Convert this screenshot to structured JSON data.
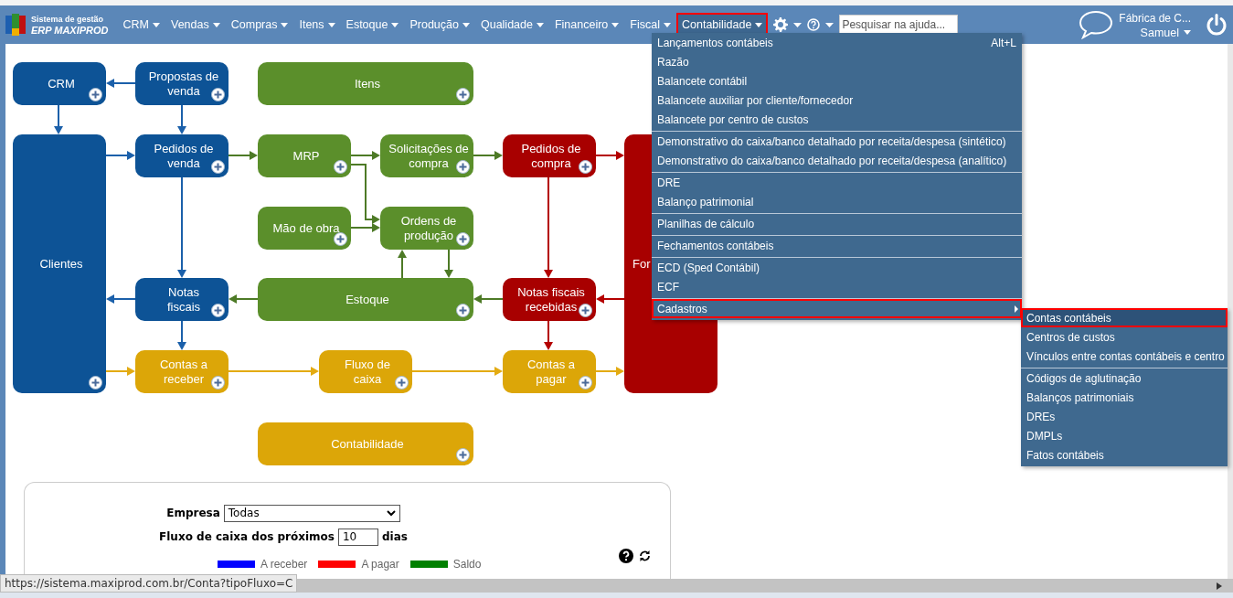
{
  "logo": {
    "line1": "Sistema de gestão",
    "line2": "ERP MAXIPROD"
  },
  "nav": [
    {
      "label": "CRM",
      "selected": false,
      "highlighted": false
    },
    {
      "label": "Vendas",
      "selected": false,
      "highlighted": false
    },
    {
      "label": "Compras",
      "selected": false,
      "highlighted": false
    },
    {
      "label": "Itens",
      "selected": false,
      "highlighted": false
    },
    {
      "label": "Estoque",
      "selected": false,
      "highlighted": false
    },
    {
      "label": "Produção",
      "selected": false,
      "highlighted": false
    },
    {
      "label": "Qualidade",
      "selected": false,
      "highlighted": false
    },
    {
      "label": "Financeiro",
      "selected": false,
      "highlighted": false
    },
    {
      "label": "Fiscal",
      "selected": false,
      "highlighted": false
    },
    {
      "label": "Contabilidade",
      "selected": true,
      "highlighted": true
    }
  ],
  "search": {
    "placeholder": "Pesquisar na ajuda..."
  },
  "user": {
    "company": "Fábrica de C...",
    "name": "Samuel"
  },
  "nodes": [
    {
      "label": "CRM",
      "color": "#0d5396"
    },
    {
      "label": "Propostas de\nvenda",
      "color": "#0d5396"
    },
    {
      "label": "Itens",
      "color": "#5b8f2b"
    },
    {
      "label": "Clientes",
      "color": "#0d5396"
    },
    {
      "label": "Pedidos de\nvenda",
      "color": "#0d5396"
    },
    {
      "label": "MRP",
      "color": "#5b8f2b"
    },
    {
      "label": "Solicitações de\ncompra",
      "color": "#5b8f2b"
    },
    {
      "label": "Pedidos de\ncompra",
      "color": "#a80000"
    },
    {
      "label": "For",
      "color": "#a80000"
    },
    {
      "label": "Mão de obra",
      "color": "#5b8f2b"
    },
    {
      "label": "Ordens de\nprodução",
      "color": "#5b8f2b"
    },
    {
      "label": "Notas\nfiscais",
      "color": "#0d5396"
    },
    {
      "label": "Estoque",
      "color": "#5b8f2b"
    },
    {
      "label": "Notas fiscais\nrecebidas",
      "color": "#a80000"
    },
    {
      "label": "Contas a\nreceber",
      "color": "#dca608"
    },
    {
      "label": "Fluxo de\ncaixa",
      "color": "#dca608"
    },
    {
      "label": "Contas a\npagar",
      "color": "#dca608"
    },
    {
      "label": "Contabilidade",
      "color": "#dca608"
    }
  ],
  "menu": {
    "sections": [
      [
        {
          "label": "Lançamentos contábeis",
          "shortcut": "Alt+L",
          "submenu": false,
          "highlighted": false
        },
        {
          "label": "Razão",
          "submenu": false,
          "highlighted": false
        },
        {
          "label": "Balancete contábil",
          "submenu": false,
          "highlighted": false
        },
        {
          "label": "Balancete auxiliar por cliente/fornecedor",
          "submenu": false,
          "highlighted": false
        },
        {
          "label": "Balancete por centro de custos",
          "submenu": false,
          "highlighted": false
        }
      ],
      [
        {
          "label": "Demonstrativo do caixa/banco detalhado por receita/despesa (sintético)",
          "submenu": false,
          "highlighted": false
        },
        {
          "label": "Demonstrativo do caixa/banco detalhado por receita/despesa (analítico)",
          "submenu": false,
          "highlighted": false
        }
      ],
      [
        {
          "label": "DRE",
          "submenu": false,
          "highlighted": false
        },
        {
          "label": "Balanço patrimonial",
          "submenu": false,
          "highlighted": false
        }
      ],
      [
        {
          "label": "Planilhas de cálculo",
          "submenu": false,
          "highlighted": false
        }
      ],
      [
        {
          "label": "Fechamentos contábeis",
          "submenu": false,
          "highlighted": false
        }
      ],
      [
        {
          "label": "ECD (Sped Contábil)",
          "submenu": false,
          "highlighted": false
        },
        {
          "label": "ECF",
          "submenu": false,
          "highlighted": false
        }
      ],
      [
        {
          "label": "Cadastros",
          "submenu": true,
          "highlighted": true
        }
      ]
    ]
  },
  "submenu": {
    "sections": [
      [
        {
          "label": "Contas contábeis",
          "selected": true,
          "highlighted": true
        },
        {
          "label": "Centros de custos",
          "selected": false,
          "highlighted": false
        },
        {
          "label": "Vínculos entre contas contábeis e centro",
          "selected": false,
          "highlighted": false
        }
      ],
      [
        {
          "label": "Códigos de aglutinação",
          "selected": false,
          "highlighted": false
        },
        {
          "label": "Balanços patrimoniais",
          "selected": false,
          "highlighted": false
        },
        {
          "label": "DREs",
          "selected": false,
          "highlighted": false
        },
        {
          "label": "DMPLs",
          "selected": false,
          "highlighted": false
        },
        {
          "label": "Fatos contábeis",
          "selected": false,
          "highlighted": false
        }
      ]
    ]
  },
  "form": {
    "company_label": "Empresa",
    "company_value": "Todas",
    "days_label": "Fluxo de caixa dos próximos",
    "days_value": "10",
    "days_suffix": "dias"
  },
  "legend": [
    {
      "label": "A receber",
      "color": "#0000ff"
    },
    {
      "label": "A pagar",
      "color": "#ff0000"
    },
    {
      "label": "Saldo",
      "color": "#008000"
    }
  ],
  "status_url": "https://sistema.maxiprod.com.br/Conta?tipoFluxo=C"
}
